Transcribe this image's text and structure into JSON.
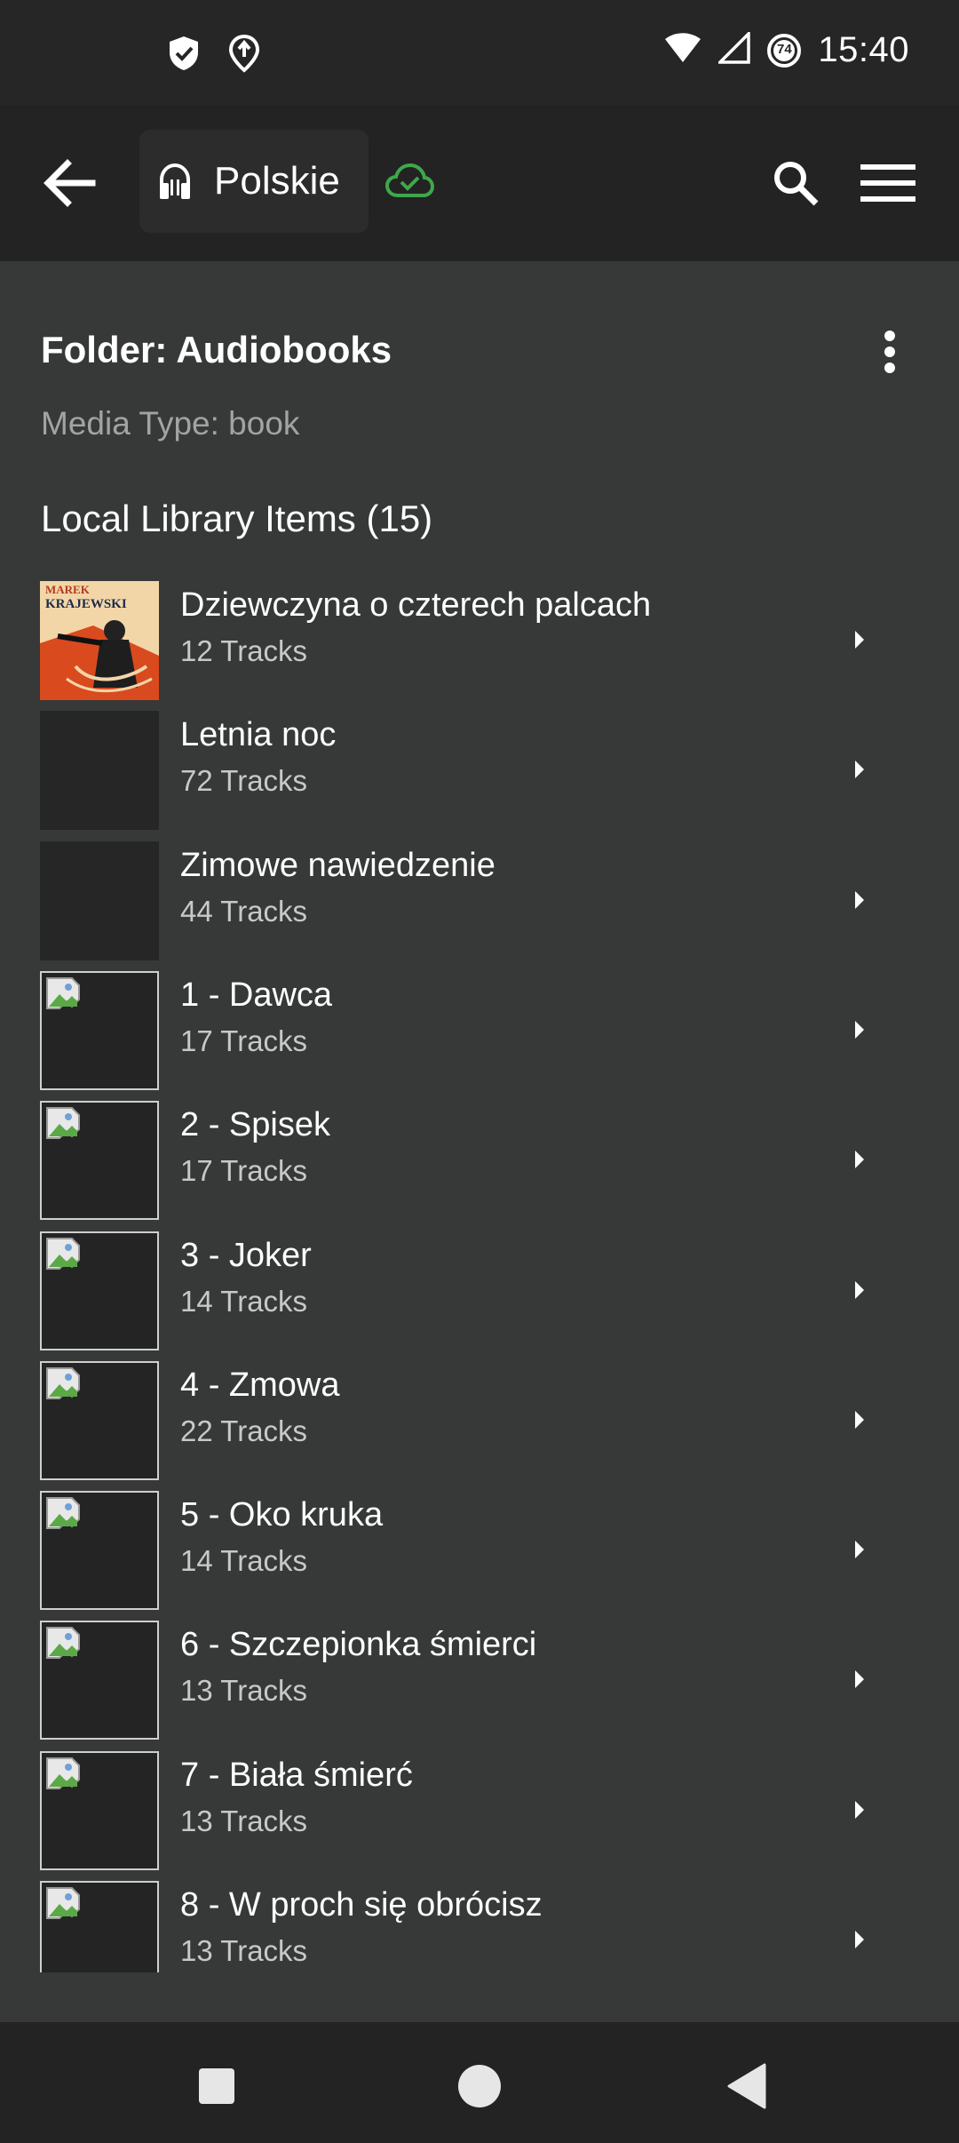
{
  "status_bar": {
    "time": "15:40",
    "battery_level": "74",
    "icons": [
      "shield-check-icon",
      "location-icon",
      "wifi-icon",
      "signal-icon",
      "battery-saver-icon"
    ]
  },
  "app_bar": {
    "back_icon": "arrow-left-icon",
    "library_name": "Polskie",
    "library_icon": "headphones-icon",
    "cloud_icon": "cloud-check-icon",
    "search_icon": "search-icon",
    "menu_icon": "hamburger-menu-icon",
    "accent_color": "#3ea84b"
  },
  "folder": {
    "title": "Folder: Audiobooks",
    "media_type": "Media Type: book",
    "more_icon": "more-vertical-icon"
  },
  "library": {
    "section_title": "Local Library Items (15)",
    "items": [
      {
        "title": "Dziewczyna o czterech palcach",
        "tracks": "12 Tracks",
        "thumb": "cover",
        "cover_text": [
          "MAREK",
          "KRAJEWSKI"
        ]
      },
      {
        "title": "Letnia noc",
        "tracks": "72 Tracks",
        "thumb": "empty"
      },
      {
        "title": "Zimowe nawiedzenie",
        "tracks": "44 Tracks",
        "thumb": "empty"
      },
      {
        "title": "1 - Dawca",
        "tracks": "17 Tracks",
        "thumb": "broken"
      },
      {
        "title": "2 - Spisek",
        "tracks": "17 Tracks",
        "thumb": "broken"
      },
      {
        "title": "3 - Joker",
        "tracks": "14 Tracks",
        "thumb": "broken"
      },
      {
        "title": "4 - Zmowa",
        "tracks": "22 Tracks",
        "thumb": "broken"
      },
      {
        "title": "5 - Oko kruka",
        "tracks": "14 Tracks",
        "thumb": "broken"
      },
      {
        "title": "6 - Szczepionka śmierci",
        "tracks": "13 Tracks",
        "thumb": "broken"
      },
      {
        "title": "7 - Biała śmierć",
        "tracks": "13 Tracks",
        "thumb": "broken"
      },
      {
        "title": "8 - W proch się obrócisz",
        "tracks": "13 Tracks",
        "thumb": "broken"
      }
    ]
  },
  "nav_bar": {
    "buttons": [
      "recents-square-icon",
      "home-circle-icon",
      "back-triangle-icon"
    ]
  }
}
